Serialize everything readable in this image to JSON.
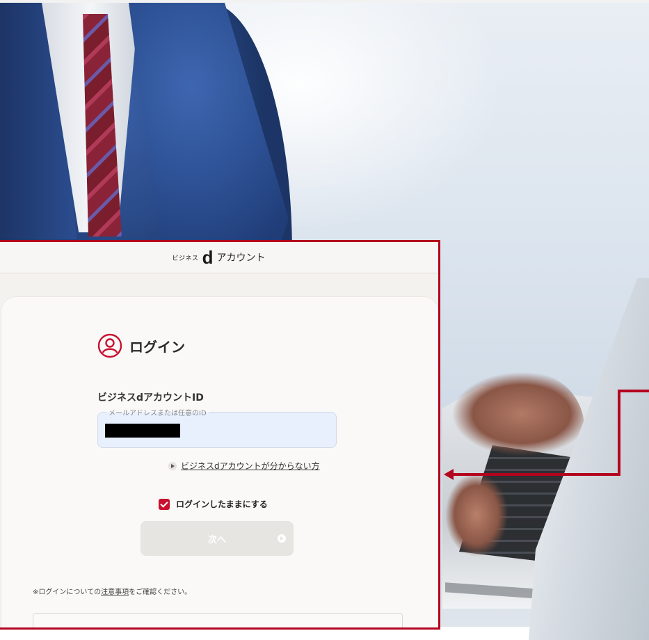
{
  "header": {
    "brand_prefix": "ビジネス",
    "brand_d": "d",
    "brand_suffix": "アカウント"
  },
  "login": {
    "title": "ログイン",
    "id_label": "ビジネスdアカウントID",
    "id_placeholder": "メールアドレスまたは任意のID",
    "forgot_link": "ビジネスdアカウントが分からない方",
    "keep_logged_in": "ログインしたままにする",
    "keep_logged_in_checked": true,
    "next_button": "次へ",
    "notice_prefix": "※ログインについての",
    "notice_link": "注意事項",
    "notice_suffix": "をご確認ください。"
  },
  "colors": {
    "accent": "#c8102e",
    "callout_border": "#b4031e",
    "input_bg": "#e8f0fe",
    "button_disabled": "#e7e5e2"
  },
  "icons": [
    "user-circle-icon",
    "play-icon",
    "check-icon",
    "arrow-right-icon"
  ]
}
